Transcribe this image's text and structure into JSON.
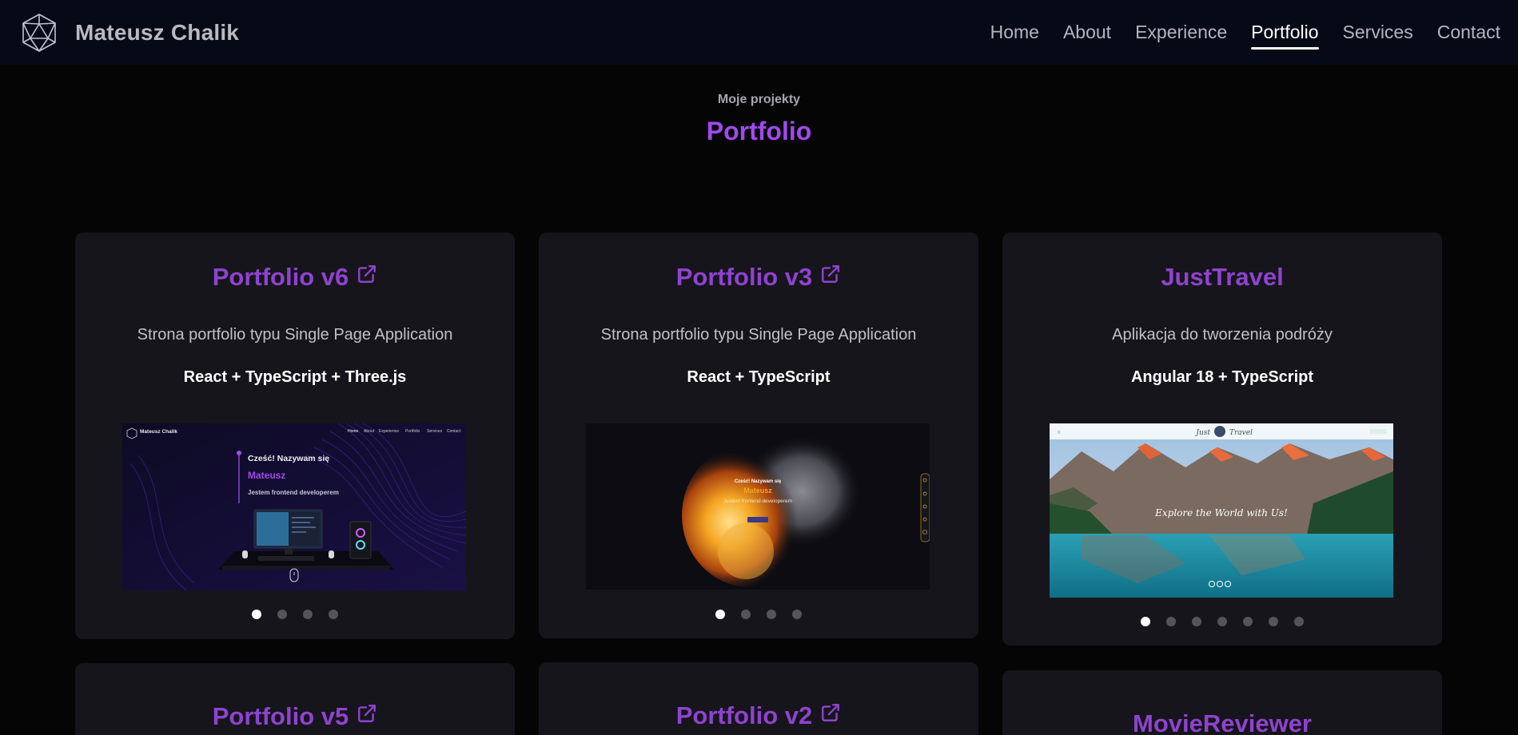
{
  "navbar": {
    "brand": "Mateusz Chalik",
    "items": [
      {
        "label": "Home",
        "active": false
      },
      {
        "label": "About",
        "active": false
      },
      {
        "label": "Experience",
        "active": false
      },
      {
        "label": "Portfolio",
        "active": true
      },
      {
        "label": "Services",
        "active": false
      },
      {
        "label": "Contact",
        "active": false
      }
    ]
  },
  "section": {
    "subtitle": "Moje projekty",
    "title": "Portfolio"
  },
  "projects": [
    {
      "title": "Portfolio v6",
      "external_link_icon": "external-link-icon",
      "description": "Strona portfolio typu Single Page Application",
      "tech": "React + TypeScript + Three.js",
      "slides": 4,
      "active_slide": 1,
      "preview": {
        "brand": "Mateusz Chalik",
        "nav": [
          "Home",
          "About",
          "Experience",
          "Portfolio",
          "Services",
          "Contact"
        ],
        "greeting": "Cześć! Nazywam się",
        "name": "Mateusz",
        "role": "Jestem frontend developerem"
      }
    },
    {
      "title": "Portfolio v3",
      "external_link_icon": "external-link-icon",
      "description": "Strona portfolio typu Single Page Application",
      "tech": "React + TypeScript",
      "slides": 4,
      "active_slide": 1,
      "preview": {
        "greeting": "Cześć! Nazywam się",
        "name": "Mateusz",
        "role": "Jestem frontend developerem"
      }
    },
    {
      "title": "JustTravel",
      "description": "Aplikacja do tworzenia podróży",
      "tech": "Angular 18 + TypeScript",
      "slides": 7,
      "active_slide": 1,
      "preview": {
        "brand_left": "Just",
        "brand_right": "Travel",
        "tagline": "Explore the World with Us!"
      }
    },
    {
      "title": "Portfolio v5",
      "external_link_icon": "external-link-icon"
    },
    {
      "title": "Portfolio v2",
      "external_link_icon": "external-link-icon"
    },
    {
      "title": "MovieReviewer"
    }
  ],
  "colors": {
    "accent": "#a149ee",
    "card_title": "#8e43cf",
    "card_bg": "#16151b",
    "nav_bg": "#060a17",
    "page_bg": "#050506"
  }
}
